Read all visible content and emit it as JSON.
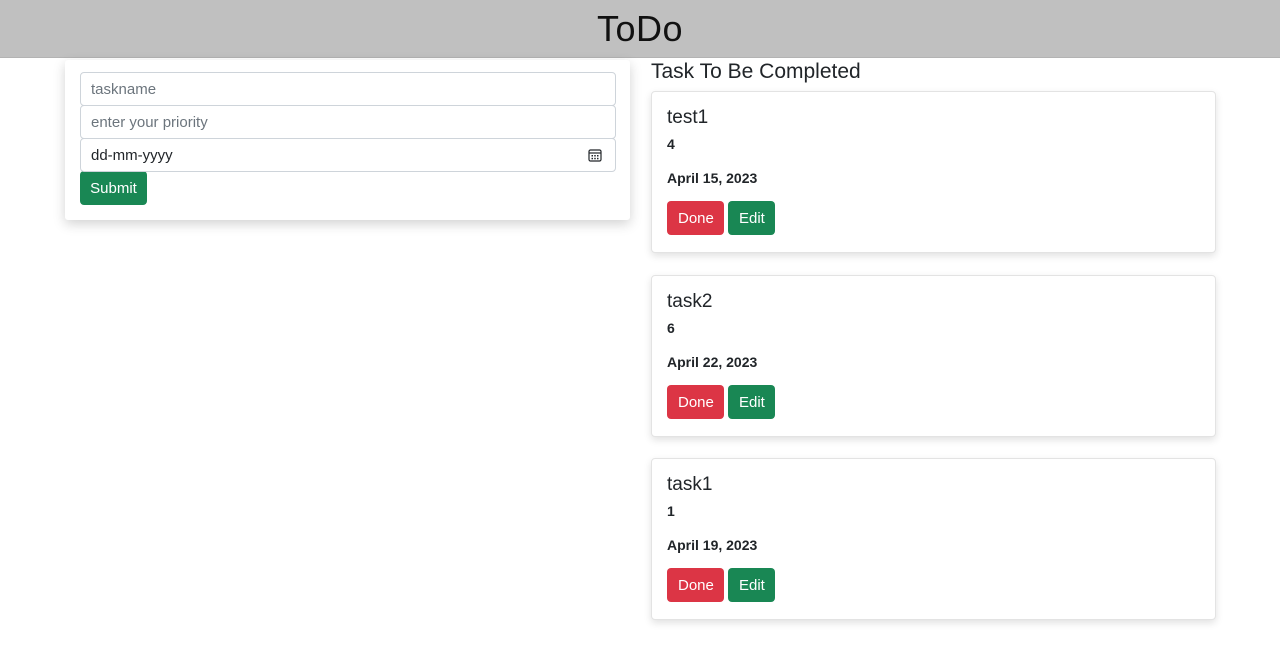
{
  "header": {
    "title": "ToDo"
  },
  "form": {
    "taskname_placeholder": "taskname",
    "priority_placeholder": "enter your priority",
    "date_value": "dd-mm-yyyy",
    "submit_label": "Submit"
  },
  "tasks_section": {
    "heading": "Task To Be Completed",
    "done_label": "Done",
    "edit_label": "Edit",
    "items": [
      {
        "name": "test1",
        "priority": "4",
        "date": "April 15, 2023"
      },
      {
        "name": "task2",
        "priority": "6",
        "date": "April 22, 2023"
      },
      {
        "name": "task1",
        "priority": "1",
        "date": "April 19, 2023"
      }
    ]
  },
  "colors": {
    "header_bg": "#c0c0c0",
    "success": "#198754",
    "danger": "#dc3545"
  }
}
